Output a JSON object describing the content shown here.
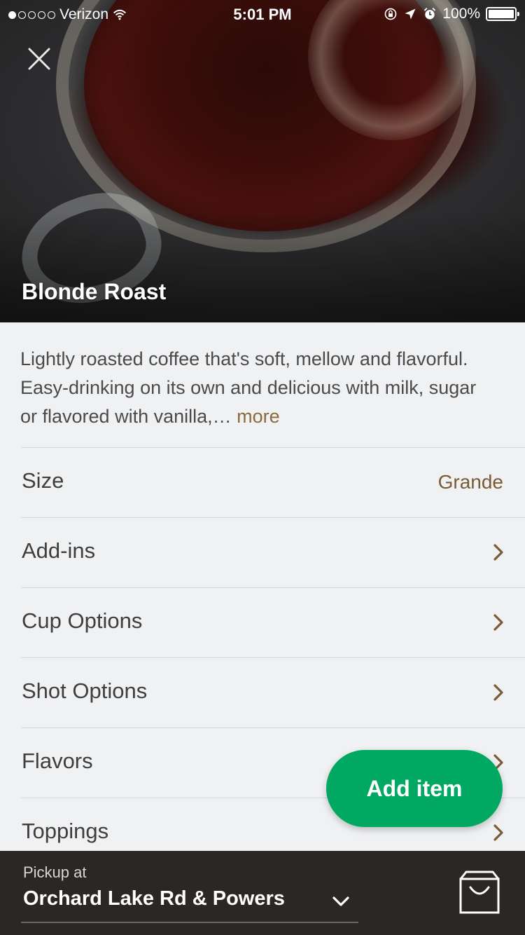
{
  "status_bar": {
    "carrier": "Verizon",
    "time": "5:01 PM",
    "battery": "100%",
    "battery_level": 1.0,
    "signal_bars_filled": 1,
    "signal_bars_total": 5
  },
  "product": {
    "name": "Blonde Roast",
    "description": "Lightly roasted coffee that's soft, mellow and flavorful. Easy-drinking on its own and delicious with milk, sugar or flavored with vanilla,…",
    "more_label": "more"
  },
  "options": [
    {
      "label": "Size",
      "value": "Grande",
      "icon": ""
    },
    {
      "label": "Add-ins",
      "value": "",
      "icon": "chevron-right-icon"
    },
    {
      "label": "Cup Options",
      "value": "",
      "icon": "chevron-right-icon"
    },
    {
      "label": "Shot Options",
      "value": "",
      "icon": "chevron-right-icon"
    },
    {
      "label": "Flavors",
      "value": "",
      "icon": "chevron-right-icon"
    },
    {
      "label": "Toppings",
      "value": "",
      "icon": "chevron-right-icon"
    }
  ],
  "add_item_label": "Add item",
  "pickup": {
    "label": "Pickup at",
    "store": "Orchard Lake Rd & Powers"
  },
  "colors": {
    "accent_green": "#00a862",
    "link_brown": "#8a6a3e",
    "bottom_bar": "#2b2725",
    "background": "#f0f1f3"
  },
  "icons": {
    "close": "close-icon",
    "chevron": "chevron-right-icon",
    "dropdown": "chevron-down-icon",
    "bag": "shopping-bag-icon"
  }
}
